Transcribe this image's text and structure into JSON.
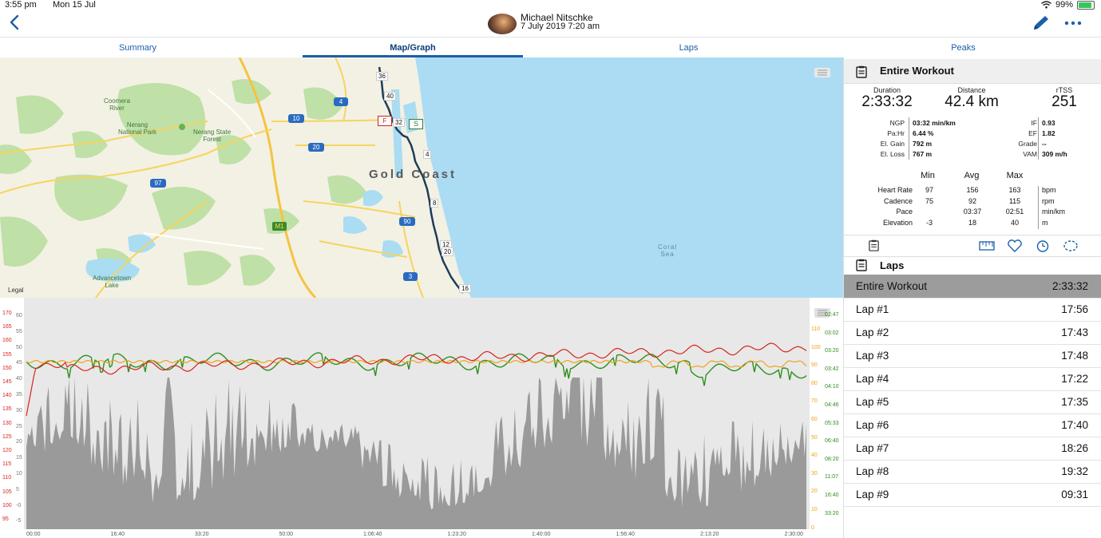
{
  "status": {
    "time": "3:55 pm",
    "date": "Mon 15 Jul",
    "battery": "99%"
  },
  "header": {
    "athlete_name": "Michael Nitschke",
    "workout_date": "7 July 2019   7:20 am"
  },
  "tabs": [
    {
      "label": "Summary"
    },
    {
      "label": "Map/Graph"
    },
    {
      "label": "Laps"
    },
    {
      "label": "Peaks"
    }
  ],
  "map": {
    "city": "Gold Coast",
    "sea": "Coral\nSea",
    "legal": "Legal",
    "places": {
      "coomera": "Coomera\nRiver",
      "nerang_np": "Nerang\nNational Park",
      "nerang_sf": "Nerang State\nForest",
      "advancetown": "Advancetown\nLake"
    },
    "road_shields": [
      "4",
      "10",
      "20",
      "97",
      "90",
      "3",
      "M1"
    ],
    "route_markers": [
      "36",
      "40",
      "32",
      "4",
      "8",
      "12",
      "20",
      "16"
    ],
    "start_flag": "S",
    "finish_flag": "F"
  },
  "graph": {
    "left_axis_hr": [
      "170",
      "165",
      "160",
      "155",
      "150",
      "145",
      "140",
      "135",
      "130",
      "125",
      "120",
      "115",
      "110",
      "105",
      "100",
      "95"
    ],
    "left_axis_elev": [
      "60",
      "55",
      "50",
      "45",
      "40",
      "35",
      "30",
      "25",
      "20",
      "15",
      "10",
      "5",
      "-0",
      "-5"
    ],
    "right_axis_cad": [
      "110",
      "100",
      "90",
      "80",
      "70",
      "60",
      "50",
      "40",
      "30",
      "20",
      "10",
      "0"
    ],
    "right_axis_pace": [
      "02:47",
      "03:02",
      "03:20",
      "03:42",
      "04:10",
      "04:46",
      "05:33",
      "06:40",
      "08:20",
      "11:07",
      "16:40",
      "33:20"
    ],
    "x_ticks": [
      "00:00",
      "16:40",
      "33:20",
      "50:00",
      "1:06:40",
      "1:23:20",
      "1:40:00",
      "1:56:40",
      "2:13:20",
      "2:30:00"
    ],
    "colors": {
      "hr": "#d9241c",
      "cadence": "#f0a21b",
      "pace": "#2f8f1e",
      "elevation": "#9a9a9a"
    }
  },
  "summary": {
    "title": "Entire Workout",
    "duration": {
      "label": "Duration",
      "value": "2:33:32"
    },
    "distance": {
      "label": "Distance",
      "value": "42.4 km"
    },
    "rtss": {
      "label": "rTSS",
      "value": "251"
    },
    "left_stats": [
      {
        "label": "NGP",
        "value": "03:32 min/km"
      },
      {
        "label": "Pa:Hr",
        "value": "6.44 %"
      },
      {
        "label": "El. Gain",
        "value": "792 m"
      },
      {
        "label": "El. Loss",
        "value": "767 m"
      }
    ],
    "right_stats": [
      {
        "label": "IF",
        "value": "0.93"
      },
      {
        "label": "EF",
        "value": "1.82"
      },
      {
        "label": "Grade",
        "value": "--"
      },
      {
        "label": "VAM",
        "value": "309 m/h"
      }
    ],
    "mm_headers": [
      "Min",
      "Avg",
      "Max"
    ],
    "mm_rows": [
      {
        "label": "Heart Rate",
        "min": "97",
        "avg": "156",
        "max": "163",
        "unit": "bpm"
      },
      {
        "label": "Cadence",
        "min": "75",
        "avg": "92",
        "max": "115",
        "unit": "rpm"
      },
      {
        "label": "Pace",
        "min": "",
        "avg": "03:37",
        "max": "02:51",
        "unit": "min/km"
      },
      {
        "label": "Elevation",
        "min": "-3",
        "avg": "18",
        "max": "40",
        "unit": "m"
      }
    ]
  },
  "laps": {
    "title": "Laps",
    "items": [
      {
        "name": "Entire Workout",
        "time": "2:33:32"
      },
      {
        "name": "Lap #1",
        "time": "17:56"
      },
      {
        "name": "Lap #2",
        "time": "17:43"
      },
      {
        "name": "Lap #3",
        "time": "17:48"
      },
      {
        "name": "Lap #4",
        "time": "17:22"
      },
      {
        "name": "Lap #5",
        "time": "17:35"
      },
      {
        "name": "Lap #6",
        "time": "17:40"
      },
      {
        "name": "Lap #7",
        "time": "18:26"
      },
      {
        "name": "Lap #8",
        "time": "19:32"
      },
      {
        "name": "Lap #9",
        "time": "09:31"
      }
    ]
  }
}
